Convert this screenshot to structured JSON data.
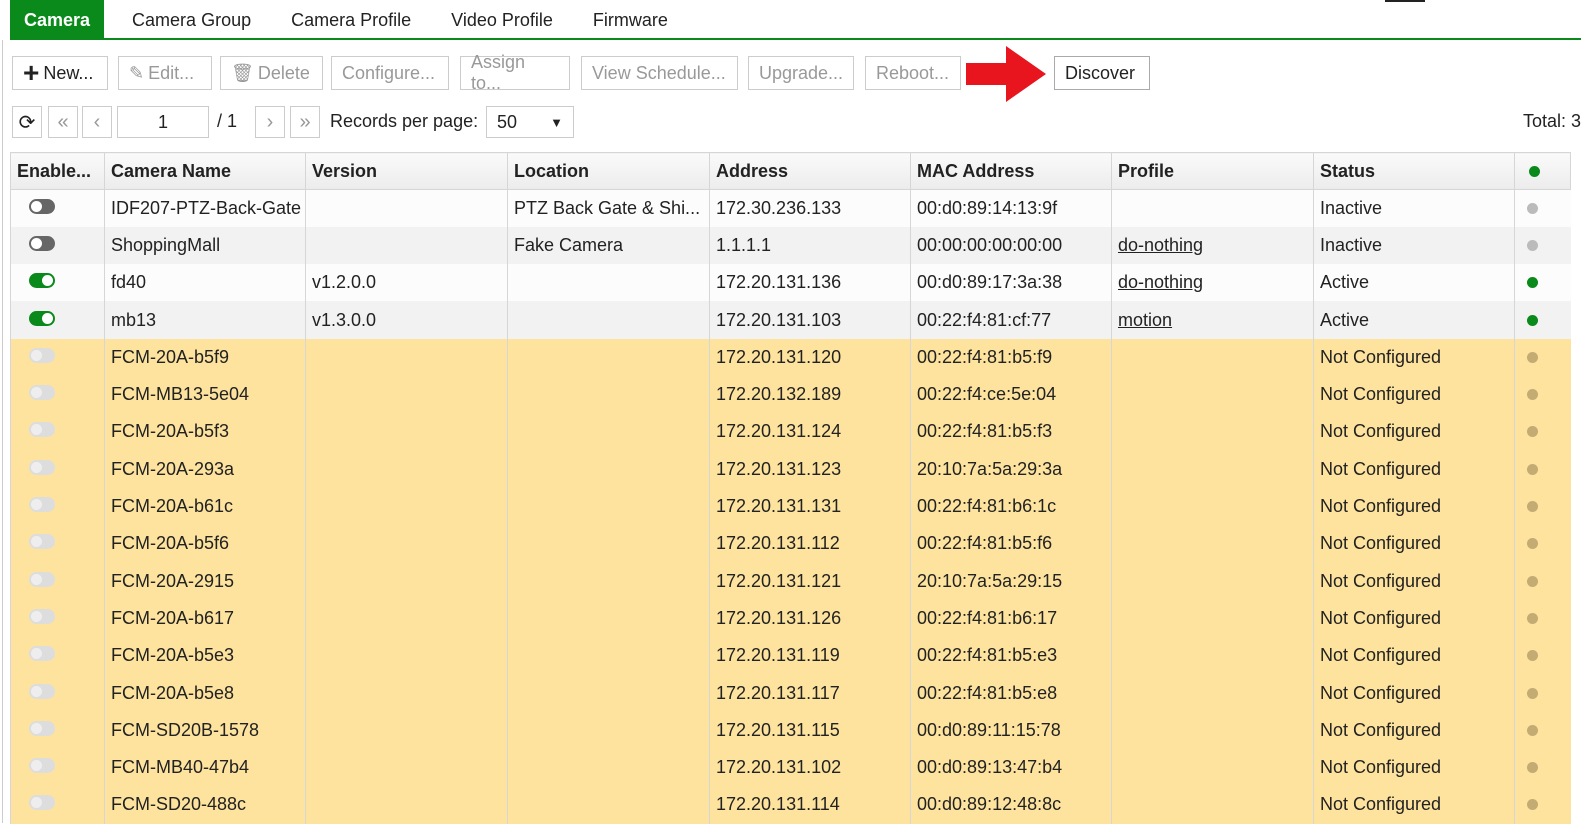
{
  "tabs": [
    "Camera",
    "Camera Group",
    "Camera Profile",
    "Video Profile",
    "Firmware"
  ],
  "toolbar": {
    "new": "New...",
    "edit": "Edit...",
    "delete": "Delete",
    "configure": "Configure...",
    "assign": "Assign to...",
    "schedule": "View Schedule...",
    "upgrade": "Upgrade...",
    "reboot": "Reboot...",
    "discover": "Discover"
  },
  "pager": {
    "page": "1",
    "of": "/ 1",
    "records_label": "Records per page:",
    "per_page": "50",
    "total": "Total: 3"
  },
  "colors": {
    "accent": "#0a8a1a",
    "arrow": "#e8141e",
    "active": "#0a8a1a",
    "inactive": "#bbbbbb",
    "notconf": "#c4ab74"
  },
  "columns": [
    "Enable...",
    "Camera Name",
    "Version",
    "Location",
    "Address",
    "MAC Address",
    "Profile",
    "Status"
  ],
  "rows": [
    {
      "enabled": "off",
      "name": "IDF207-PTZ-Back-Gate",
      "version": "",
      "location": "PTZ Back Gate & Shi...",
      "address": "172.30.236.133",
      "mac": "00:d0:89:14:13:9f",
      "profile": "",
      "status": "Inactive"
    },
    {
      "enabled": "off",
      "name": "ShoppingMall",
      "version": "",
      "location": "Fake Camera",
      "address": "1.1.1.1",
      "mac": "00:00:00:00:00:00",
      "profile": "do-nothing",
      "status": "Inactive"
    },
    {
      "enabled": "on",
      "name": "fd40",
      "version": "v1.2.0.0",
      "location": "",
      "address": "172.20.131.136",
      "mac": "00:d0:89:17:3a:38",
      "profile": "do-nothing",
      "status": "Active"
    },
    {
      "enabled": "on",
      "name": "mb13",
      "version": "v1.3.0.0",
      "location": "",
      "address": "172.20.131.103",
      "mac": "00:22:f4:81:cf:77",
      "profile": "motion",
      "status": "Active"
    },
    {
      "enabled": "dis",
      "name": "FCM-20A-b5f9",
      "version": "",
      "location": "",
      "address": "172.20.131.120",
      "mac": "00:22:f4:81:b5:f9",
      "profile": "",
      "status": "Not Configured"
    },
    {
      "enabled": "dis",
      "name": "FCM-MB13-5e04",
      "version": "",
      "location": "",
      "address": "172.20.132.189",
      "mac": "00:22:f4:ce:5e:04",
      "profile": "",
      "status": "Not Configured"
    },
    {
      "enabled": "dis",
      "name": "FCM-20A-b5f3",
      "version": "",
      "location": "",
      "address": "172.20.131.124",
      "mac": "00:22:f4:81:b5:f3",
      "profile": "",
      "status": "Not Configured"
    },
    {
      "enabled": "dis",
      "name": "FCM-20A-293a",
      "version": "",
      "location": "",
      "address": "172.20.131.123",
      "mac": "20:10:7a:5a:29:3a",
      "profile": "",
      "status": "Not Configured"
    },
    {
      "enabled": "dis",
      "name": "FCM-20A-b61c",
      "version": "",
      "location": "",
      "address": "172.20.131.131",
      "mac": "00:22:f4:81:b6:1c",
      "profile": "",
      "status": "Not Configured"
    },
    {
      "enabled": "dis",
      "name": "FCM-20A-b5f6",
      "version": "",
      "location": "",
      "address": "172.20.131.112",
      "mac": "00:22:f4:81:b5:f6",
      "profile": "",
      "status": "Not Configured"
    },
    {
      "enabled": "dis",
      "name": "FCM-20A-2915",
      "version": "",
      "location": "",
      "address": "172.20.131.121",
      "mac": "20:10:7a:5a:29:15",
      "profile": "",
      "status": "Not Configured"
    },
    {
      "enabled": "dis",
      "name": "FCM-20A-b617",
      "version": "",
      "location": "",
      "address": "172.20.131.126",
      "mac": "00:22:f4:81:b6:17",
      "profile": "",
      "status": "Not Configured"
    },
    {
      "enabled": "dis",
      "name": "FCM-20A-b5e3",
      "version": "",
      "location": "",
      "address": "172.20.131.119",
      "mac": "00:22:f4:81:b5:e3",
      "profile": "",
      "status": "Not Configured"
    },
    {
      "enabled": "dis",
      "name": "FCM-20A-b5e8",
      "version": "",
      "location": "",
      "address": "172.20.131.117",
      "mac": "00:22:f4:81:b5:e8",
      "profile": "",
      "status": "Not Configured"
    },
    {
      "enabled": "dis",
      "name": "FCM-SD20B-1578",
      "version": "",
      "location": "",
      "address": "172.20.131.115",
      "mac": "00:d0:89:11:15:78",
      "profile": "",
      "status": "Not Configured"
    },
    {
      "enabled": "dis",
      "name": "FCM-MB40-47b4",
      "version": "",
      "location": "",
      "address": "172.20.131.102",
      "mac": "00:d0:89:13:47:b4",
      "profile": "",
      "status": "Not Configured"
    },
    {
      "enabled": "dis",
      "name": "FCM-SD20-488c",
      "version": "",
      "location": "",
      "address": "172.20.131.114",
      "mac": "00:d0:89:12:48:8c",
      "profile": "",
      "status": "Not Configured"
    }
  ]
}
